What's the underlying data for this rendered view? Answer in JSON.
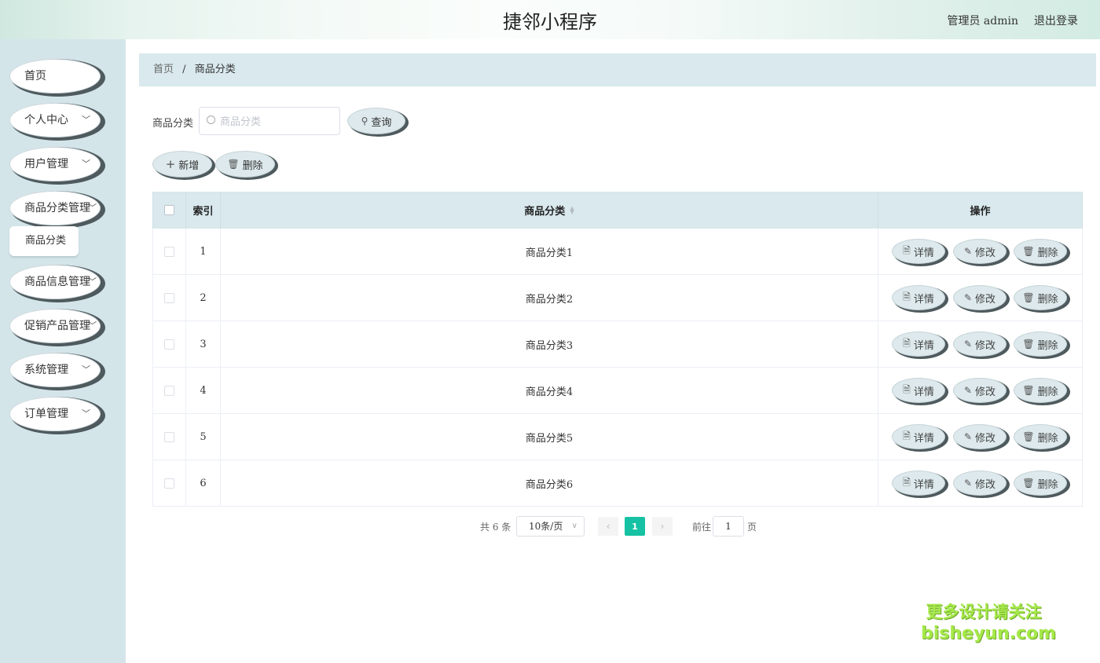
{
  "header": {
    "title": "捷邻小程序",
    "user_label": "管理员 admin",
    "logout_label": "退出登录"
  },
  "sidebar": {
    "items": [
      {
        "label": "首页",
        "has_children": false
      },
      {
        "label": "个人中心",
        "has_children": true
      },
      {
        "label": "用户管理",
        "has_children": true
      },
      {
        "label": "商品分类管理",
        "has_children": true
      },
      {
        "label": "商品信息管理",
        "has_children": true
      },
      {
        "label": "促销产品管理",
        "has_children": true
      },
      {
        "label": "系统管理",
        "has_children": true
      },
      {
        "label": "订单管理",
        "has_children": true
      }
    ],
    "submenu": {
      "label": "商品分类"
    },
    "chevron_glyph": "﹀"
  },
  "breadcrumb": {
    "home": "首页",
    "separator": "/",
    "current": "商品分类"
  },
  "search": {
    "label": "商品分类",
    "placeholder": "商品分类",
    "value": "",
    "button_label": "查询"
  },
  "toolbar": {
    "add_label": "新增",
    "delete_label": "删除"
  },
  "table": {
    "headers": {
      "index": "索引",
      "name": "商品分类",
      "ops": "操作"
    },
    "rows": [
      {
        "index": "1",
        "name": "商品分类1"
      },
      {
        "index": "2",
        "name": "商品分类2"
      },
      {
        "index": "3",
        "name": "商品分类3"
      },
      {
        "index": "4",
        "name": "商品分类4"
      },
      {
        "index": "5",
        "name": "商品分类5"
      },
      {
        "index": "6",
        "name": "商品分类6"
      }
    ],
    "row_actions": {
      "detail": "详情",
      "edit": "修改",
      "delete": "删除"
    }
  },
  "pagination": {
    "total": "共 6 条",
    "page_size": "10条/页",
    "current_page": "1",
    "goto_label": "前往",
    "goto_value": "1",
    "goto_unit": "页",
    "accent_color": "#16c2a3"
  },
  "watermark": {
    "line1": "更多设计请关注",
    "line2": "bisheyun.com"
  },
  "colors": {
    "sidebar_bg": "#d4e5ea",
    "header_bar_bg": "#d9e9ee",
    "pill_bg": "#dde9ec",
    "pill_shadow": "#4e5a5d"
  },
  "icons": {
    "search": "search-icon",
    "add": "plus-icon",
    "delete": "trash-icon",
    "detail": "document-icon",
    "edit": "pencil-icon",
    "prev": "chevron-left-icon",
    "next": "chevron-right-icon",
    "dropdown": "chevron-down-icon"
  }
}
